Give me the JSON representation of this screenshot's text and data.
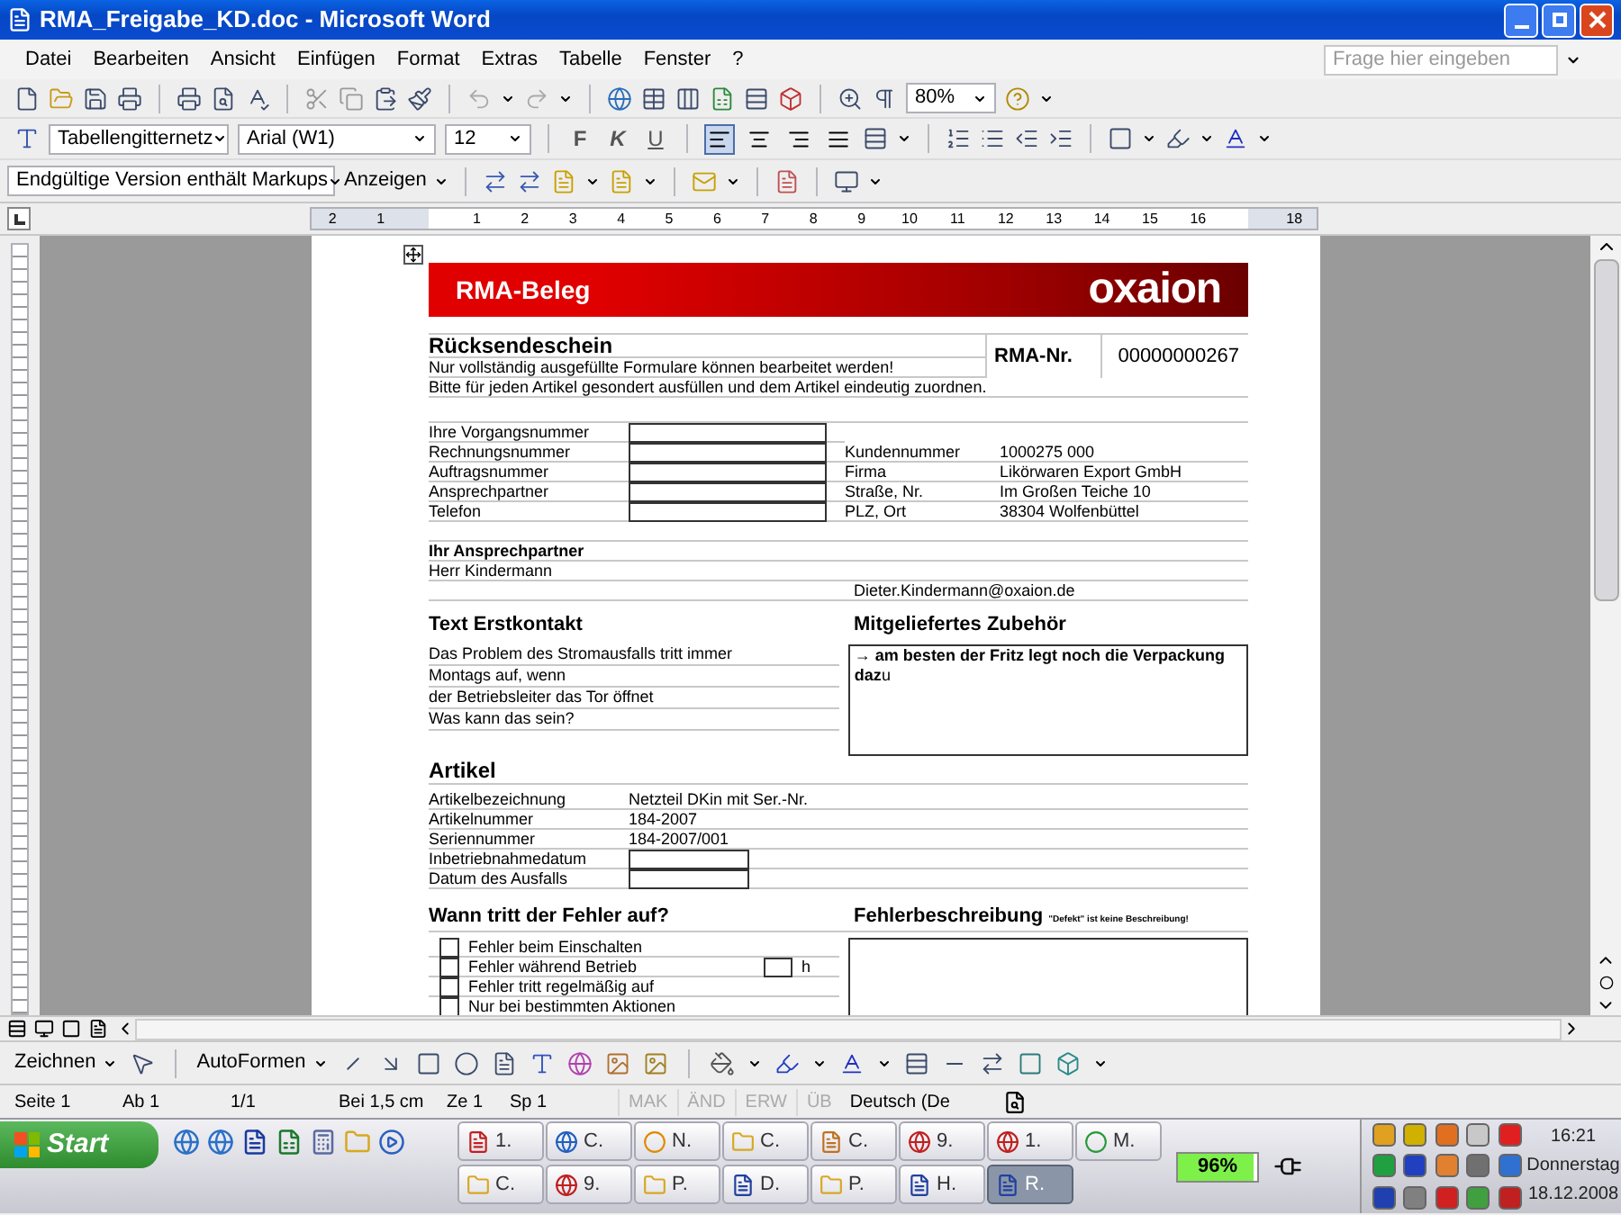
{
  "window": {
    "title": "RMA_Freigabe_KD.doc - Microsoft Word"
  },
  "menu": [
    "Datei",
    "Bearbeiten",
    "Ansicht",
    "Einfügen",
    "Format",
    "Extras",
    "Tabelle",
    "Fenster",
    "?"
  ],
  "help_search": {
    "placeholder": "Frage hier eingeben"
  },
  "standard_toolbar": {
    "zoom": "80%"
  },
  "formatting_toolbar": {
    "style": "Tabellengitternetz",
    "font": "Arial (W1)",
    "size": "12",
    "format_buttons": [
      "F",
      "K",
      "U"
    ],
    "alignment": [
      {
        "selected": true
      },
      {
        "selected": false
      },
      {
        "selected": false
      },
      {
        "selected": false
      }
    ]
  },
  "review_toolbar": {
    "view": "Endgültige Version enthält Markups",
    "show_button": "Anzeigen"
  },
  "ruler": {
    "numbers": [
      "2",
      "1",
      "1",
      "2",
      "3",
      "4",
      "5",
      "6",
      "7",
      "8",
      "9",
      "10",
      "11",
      "12",
      "13",
      "14",
      "15",
      "16",
      "18"
    ]
  },
  "document": {
    "banner_title": "RMA-Beleg",
    "logo": "oxaion",
    "heading": "Rücksendeschein",
    "notes": [
      "Nur vollständig ausgefüllte Formulare können bearbeitet werden!",
      "Bitte für jeden Artikel gesondert ausfüllen und dem Artikel eindeutig zuordnen."
    ],
    "rma_label": "RMA-Nr.",
    "rma_number": "00000000267",
    "input_fields": [
      {
        "label": "Ihre Vorgangsnummer"
      },
      {
        "label": "Rechnungsnummer"
      },
      {
        "label": "Auftragsnummer"
      },
      {
        "label": "Ansprechpartner"
      },
      {
        "label": "Telefon"
      }
    ],
    "customer": [
      {
        "label": "Kundennummer",
        "value": "1000275 000"
      },
      {
        "label": "Firma",
        "value": "Likörwaren Export GmbH"
      },
      {
        "label": "Straße, Nr.",
        "value": "Im Großen Teiche 10"
      },
      {
        "label": "PLZ, Ort",
        "value": "38304 Wolfenbüttel"
      }
    ],
    "contact_heading": "Ihr Ansprechpartner",
    "contact_name": "Herr Kindermann",
    "contact_email": "Dieter.Kindermann@oxaion.de",
    "first_contact": {
      "title": "Text Erstkontakt",
      "lines": [
        "Das Problem des Stromausfalls tritt immer",
        "Montags auf, wenn",
        "der Betriebsleiter das Tor öffnet",
        "Was kann das sein?"
      ]
    },
    "accessories": {
      "title": "Mitgeliefertes Zubehör",
      "text": "**→ am besten der Fritz legt noch die Verpackung daz**u"
    },
    "article": {
      "title": "Artikel",
      "rows": [
        {
          "kind": "text",
          "label": "Artikelbezeichnung",
          "value": "Netzteil DKin mit Ser.-Nr."
        },
        {
          "kind": "text",
          "label": "Artikelnummer",
          "value": "184-2007"
        },
        {
          "kind": "text",
          "label": "Seriennummer",
          "value": "184-2007/001"
        },
        {
          "kind": "field",
          "label": "Inbetriebnahmedatum"
        },
        {
          "kind": "field",
          "label": "Datum des Ausfalls"
        }
      ]
    },
    "error_timing": {
      "title": "Wann tritt der Fehler auf?",
      "options": [
        {
          "label": "Fehler beim Einschalten",
          "checked": false
        },
        {
          "label": "Fehler während Betrieb",
          "checked": false,
          "unit": "h"
        },
        {
          "label": "Fehler tritt regelmäßig auf",
          "checked": false
        },
        {
          "label": "Nur bei bestimmten Aktionen",
          "checked": false
        }
      ]
    },
    "error_description": {
      "title": "Fehlerbeschreibung",
      "hint": "\"Defekt\" ist keine Beschreibung!"
    }
  },
  "drawing_toolbar": {
    "draw_button": "Zeichnen",
    "autoshapes_button": "AutoFormen"
  },
  "status_bar": {
    "fields": [
      "Seite 1",
      "Ab 1",
      "1/1",
      "Bei 1,5 cm",
      "Ze 1",
      "Sp 1"
    ],
    "modes": [
      {
        "label": "MAK",
        "on": false
      },
      {
        "label": "ÄND",
        "on": false
      },
      {
        "label": "ERW",
        "on": false
      },
      {
        "label": "ÜB",
        "on": false
      }
    ],
    "language": "Deutsch (De"
  },
  "taskbar": {
    "start": "Start",
    "task_rows": [
      [
        {
          "label": "1.",
          "selected": false
        },
        {
          "label": "C.",
          "selected": false
        },
        {
          "label": "N.",
          "selected": false
        },
        {
          "label": "C.",
          "selected": false
        },
        {
          "label": "C.",
          "selected": false
        },
        {
          "label": "9.",
          "selected": false
        },
        {
          "label": "1.",
          "selected": false
        },
        {
          "label": "M.",
          "selected": false
        }
      ],
      [
        {
          "label": "C.",
          "selected": false
        },
        {
          "label": "9.",
          "selected": false
        },
        {
          "label": "P.",
          "selected": false
        },
        {
          "label": "D.",
          "selected": false
        },
        {
          "label": "P.",
          "selected": false
        },
        {
          "label": "H.",
          "selected": false
        },
        {
          "label": "R.",
          "selected": true
        }
      ]
    ],
    "battery": {
      "reading": "96%",
      "level": 0.96
    },
    "clock": {
      "time": "16:21",
      "day": "Donnerstag",
      "date": "18.12.2008"
    }
  }
}
